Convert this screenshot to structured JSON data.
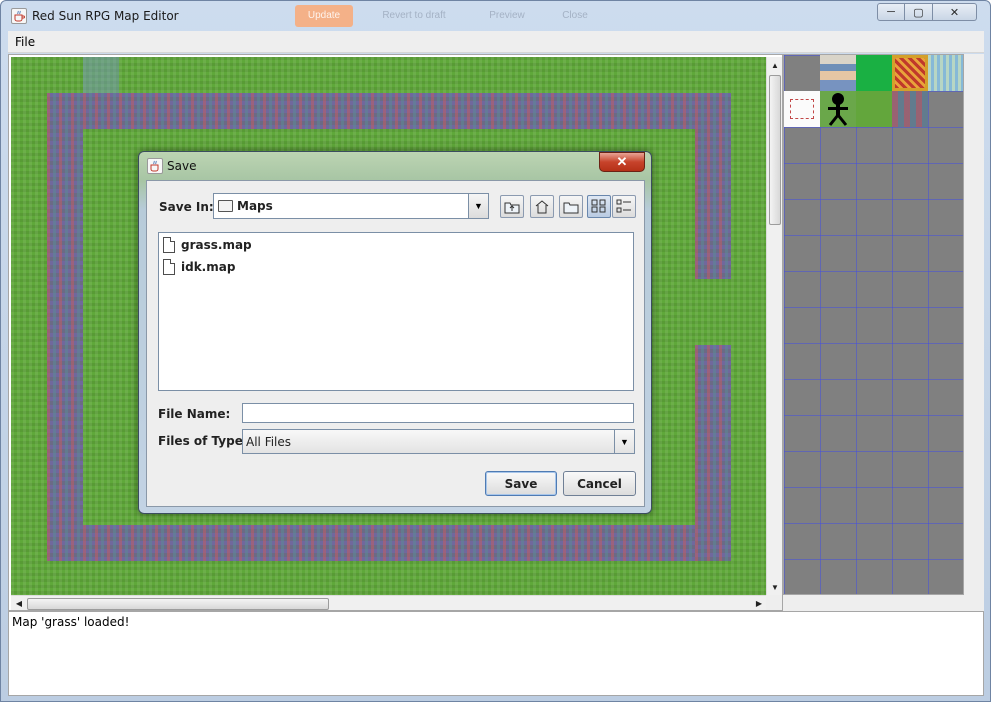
{
  "window": {
    "title": "Red Sun RPG Map Editor",
    "controls": {
      "minimize": "─",
      "maximize": "▢",
      "close": "✕"
    },
    "ghost_toolbar": [
      "Update",
      "Revert to draft",
      "Preview",
      "Close"
    ]
  },
  "menubar": {
    "items": [
      {
        "label": "File"
      }
    ]
  },
  "map": {
    "base_tile": "grass",
    "border_tile": "stone-wall"
  },
  "tile_palette": {
    "tiles": [
      "hero-sprite",
      "grass-solid",
      "carpet",
      "water",
      "map-scroll",
      "stick-figure",
      "grass",
      "stone-wall"
    ],
    "grid_color": "#4650dc"
  },
  "status": {
    "message": "Map 'grass' loaded!"
  },
  "save_dialog": {
    "title": "Save",
    "close_glyph": "✕",
    "save_in_label": "Save In:",
    "save_in_value": "Maps",
    "files": [
      {
        "name": "grass.map"
      },
      {
        "name": "idk.map"
      }
    ],
    "file_name_label": "File Name:",
    "file_name_value": "",
    "file_type_label": "Files of Type:",
    "file_type_value": "All Files",
    "save_button": "Save",
    "cancel_button": "Cancel",
    "toolbar_icons": [
      "up-folder-icon",
      "home-icon",
      "new-folder-icon",
      "list-view-icon",
      "details-view-icon"
    ]
  },
  "colors": {
    "dialog_close": "#c7432b",
    "grass": "#5fa83a",
    "palette_bg": "#808080"
  }
}
